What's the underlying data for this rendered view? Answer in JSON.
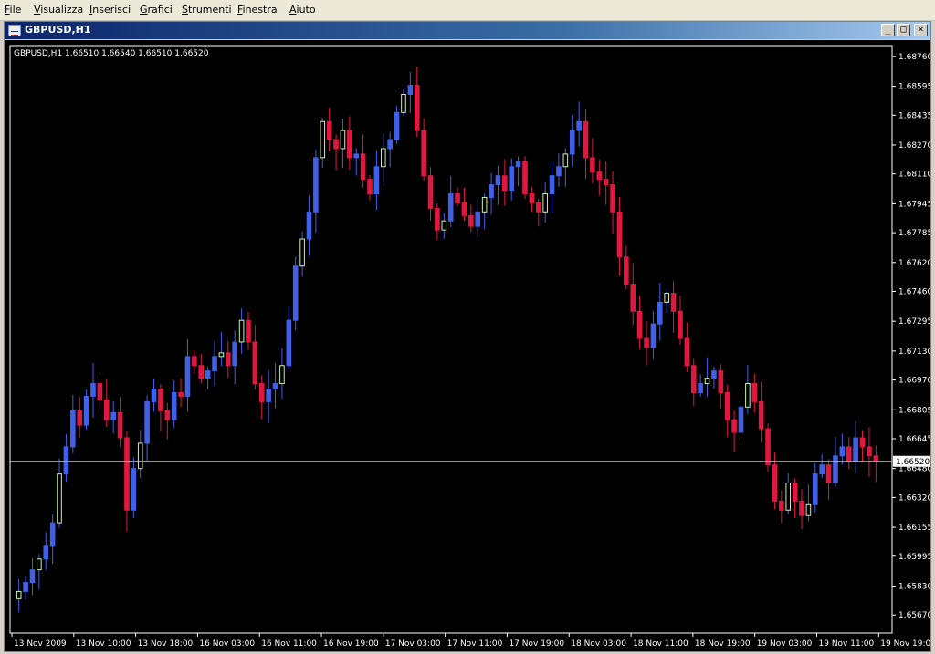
{
  "menu": [
    {
      "label": "File",
      "underline": "F"
    },
    {
      "label": "Visualizza",
      "underline": "V"
    },
    {
      "label": "Inserisci",
      "underline": "I"
    },
    {
      "label": "Grafici",
      "underline": "G"
    },
    {
      "label": "Strumenti",
      "underline": "S"
    },
    {
      "label": "Finestra",
      "underline": "F"
    },
    {
      "label": "Aiuto",
      "underline": "A"
    }
  ],
  "window": {
    "title": "GBPUSD,H1",
    "buttons": {
      "minimize": "_",
      "maximize": "□",
      "close": "×"
    }
  },
  "chart_data": {
    "type": "candlestick",
    "symbol": "GBPUSD",
    "timeframe": "H1",
    "info_line": "GBPUSD,H1  1.66510 1.66540 1.66510 1.66520",
    "current_price": "1.66520",
    "current_price_value": 1.6652,
    "ylim": [
      1.6557,
      1.6882
    ],
    "y_ticks": [
      "1.68760",
      "1.68595",
      "1.68435",
      "1.68270",
      "1.68110",
      "1.67945",
      "1.67785",
      "1.67620",
      "1.67460",
      "1.67295",
      "1.67130",
      "1.66970",
      "1.66805",
      "1.66645",
      "1.66480",
      "1.66320",
      "1.66155",
      "1.65995",
      "1.65830",
      "1.65670"
    ],
    "x_ticks": [
      "13 Nov 2009",
      "13 Nov 10:00",
      "13 Nov 18:00",
      "16 Nov 03:00",
      "16 Nov 11:00",
      "16 Nov 19:00",
      "17 Nov 03:00",
      "17 Nov 11:00",
      "17 Nov 19:00",
      "18 Nov 03:00",
      "18 Nov 11:00",
      "18 Nov 19:00",
      "19 Nov 03:00",
      "19 Nov 11:00",
      "19 Nov 19:00"
    ],
    "colors": {
      "background": "#000000",
      "bull_filled": "#4060e8",
      "bull_hollow": "#c8f0b0",
      "bear": "#e01840",
      "wick_up": "#4060e8",
      "wick_down": "#e01840",
      "axis": "#ffffff",
      "price_line": "#c0c0c0"
    },
    "close_series": [
      1.658,
      1.6585,
      1.6592,
      1.6598,
      1.6605,
      1.6618,
      1.6645,
      1.666,
      1.668,
      1.6672,
      1.6688,
      1.6695,
      1.6686,
      1.6675,
      1.6679,
      1.6665,
      1.6625,
      1.6648,
      1.6662,
      1.6685,
      1.6692,
      1.668,
      1.6675,
      1.669,
      1.6688,
      1.671,
      1.6705,
      1.6698,
      1.6702,
      1.671,
      1.6712,
      1.6705,
      1.6718,
      1.673,
      1.6718,
      1.6695,
      1.6685,
      1.6692,
      1.6695,
      1.6705,
      1.673,
      1.676,
      1.6775,
      1.679,
      1.682,
      1.684,
      1.683,
      1.6825,
      1.6835,
      1.682,
      1.6822,
      1.6808,
      1.68,
      1.6815,
      1.6825,
      1.683,
      1.6845,
      1.6855,
      1.686,
      1.6835,
      1.681,
      1.6792,
      1.678,
      1.6785,
      1.68,
      1.6795,
      1.6788,
      1.6782,
      1.679,
      1.6798,
      1.6805,
      1.681,
      1.6802,
      1.6815,
      1.6818,
      1.68,
      1.6795,
      1.679,
      1.68,
      1.681,
      1.6815,
      1.6822,
      1.6835,
      1.684,
      1.682,
      1.6812,
      1.6808,
      1.6805,
      1.679,
      1.6765,
      1.675,
      1.6735,
      1.672,
      1.6715,
      1.6728,
      1.674,
      1.6745,
      1.6735,
      1.672,
      1.6705,
      1.669,
      1.6695,
      1.6698,
      1.6702,
      1.669,
      1.6675,
      1.6668,
      1.6682,
      1.6695,
      1.6685,
      1.667,
      1.665,
      1.663,
      1.6625,
      1.664,
      1.663,
      1.6622,
      1.6628,
      1.6645,
      1.665,
      1.664,
      1.6655,
      1.666,
      1.6652,
      1.6665,
      1.666,
      1.6655,
      1.6652
    ]
  }
}
